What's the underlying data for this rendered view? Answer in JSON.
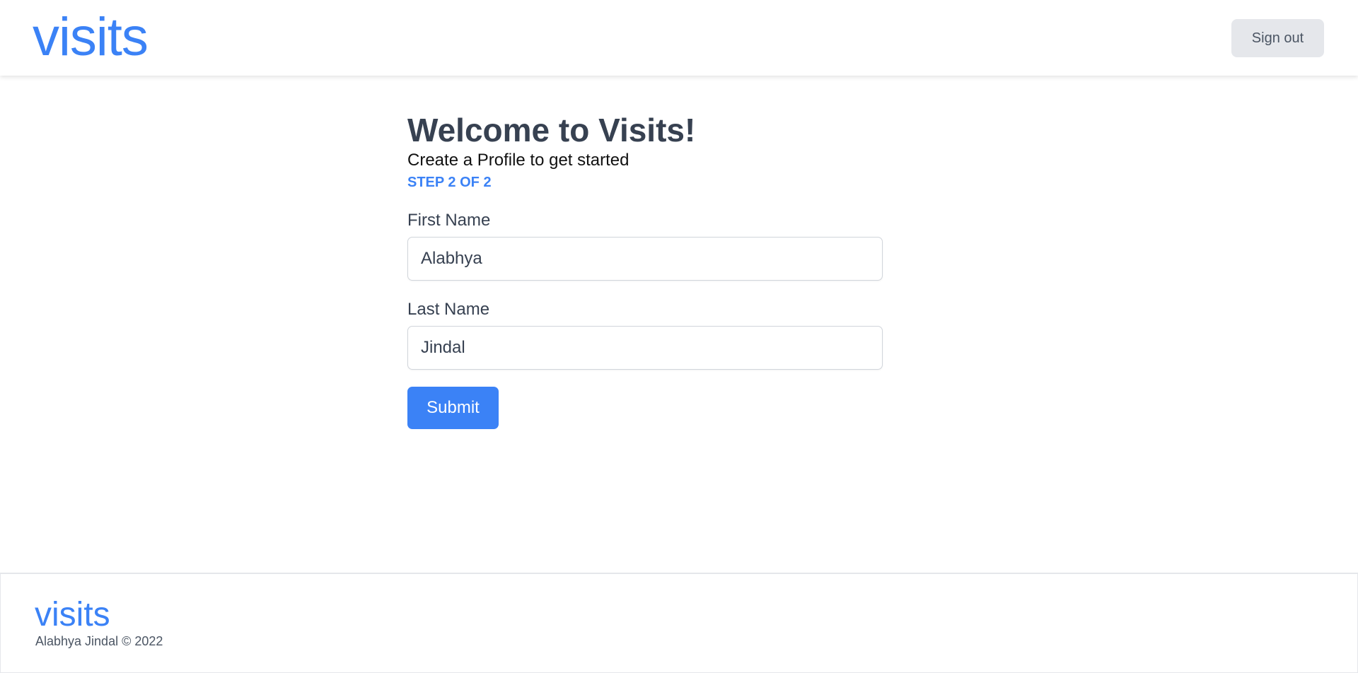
{
  "header": {
    "logo": "visits",
    "signout_label": "Sign out"
  },
  "main": {
    "title": "Welcome to Visits!",
    "subtitle": "Create a Profile to get started",
    "step": "STEP 2 OF 2",
    "first_name": {
      "label": "First Name",
      "value": "Alabhya"
    },
    "last_name": {
      "label": "Last Name",
      "value": "Jindal"
    },
    "submit_label": "Submit"
  },
  "footer": {
    "logo": "visits",
    "copyright": "Alabhya Jindal © 2022"
  },
  "colors": {
    "brand": "#3b82f6",
    "text": "#374151",
    "muted_button": "#e5e7eb"
  }
}
